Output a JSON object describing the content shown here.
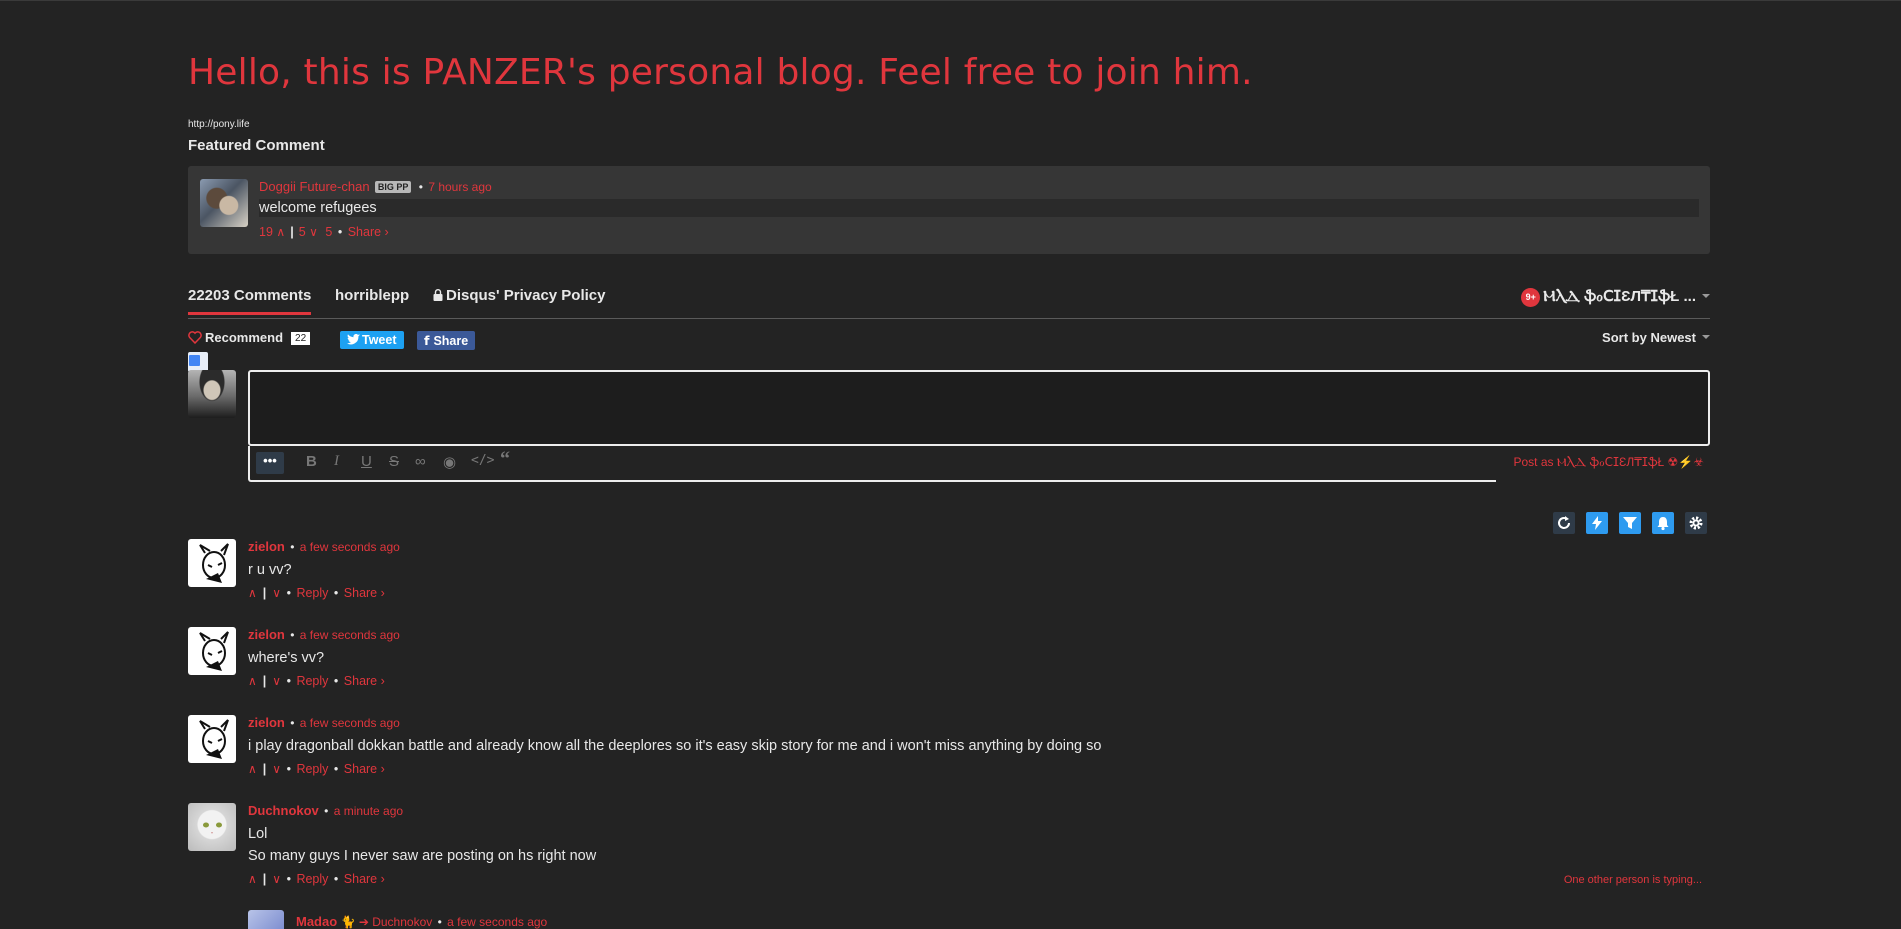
{
  "blog": {
    "title": "Hello, this is PANZER's personal blog. Feel free to join him.",
    "url": "http://pony.life",
    "featured_heading": "Featured Comment"
  },
  "featured": {
    "author": "Doggii Future-chan",
    "badge": "BIG PP",
    "time": "7 hours ago",
    "text": "welcome refugees",
    "upvotes": "19",
    "downvotes": "5",
    "downvotes_total": "5",
    "share": "Share ›"
  },
  "tabs": {
    "comments": "22203 Comments",
    "community": "horriblepp",
    "privacy": "Disqus' Privacy Policy",
    "user": "ⲘⲖⲆ ֆℴⅭⵊƐЛ₸ⵊֆŁ ...",
    "notif": "9+"
  },
  "actions": {
    "recommend": "Recommend",
    "recommend_count": "22",
    "tweet": "Tweet",
    "share": "Share",
    "sort_prefix": "Sort by",
    "sort_value": "Newest"
  },
  "editor": {
    "more": "•••",
    "post_as": "Post as ⲘⲖⲆ ֆℴⅭⵊƐЛ₸ⵊֆŁ ☢⚡☣"
  },
  "comments": [
    {
      "author": "zielon",
      "time": "a few seconds ago",
      "lines": [
        "r u vv?"
      ],
      "reply": "Reply",
      "share": "Share ›"
    },
    {
      "author": "zielon",
      "time": "a few seconds ago",
      "lines": [
        "where's vv?"
      ],
      "reply": "Reply",
      "share": "Share ›"
    },
    {
      "author": "zielon",
      "time": "a few seconds ago",
      "lines": [
        "i play dragonball dokkan battle and already know all the deeplores so it's easy skip story for me and i won't miss anything by doing so"
      ],
      "reply": "Reply",
      "share": "Share ›"
    },
    {
      "author": "Duchnokov",
      "time": "a minute ago",
      "lines": [
        "Lol",
        "So many guys I never saw are posting on hs right now"
      ],
      "reply": "Reply",
      "share": "Share ›"
    }
  ],
  "typing": "One other person is typing...",
  "reply_preview": {
    "author": "Madao",
    "emoji": "🐈",
    "reply_to": "Duchnokov",
    "time": "a few seconds ago"
  }
}
